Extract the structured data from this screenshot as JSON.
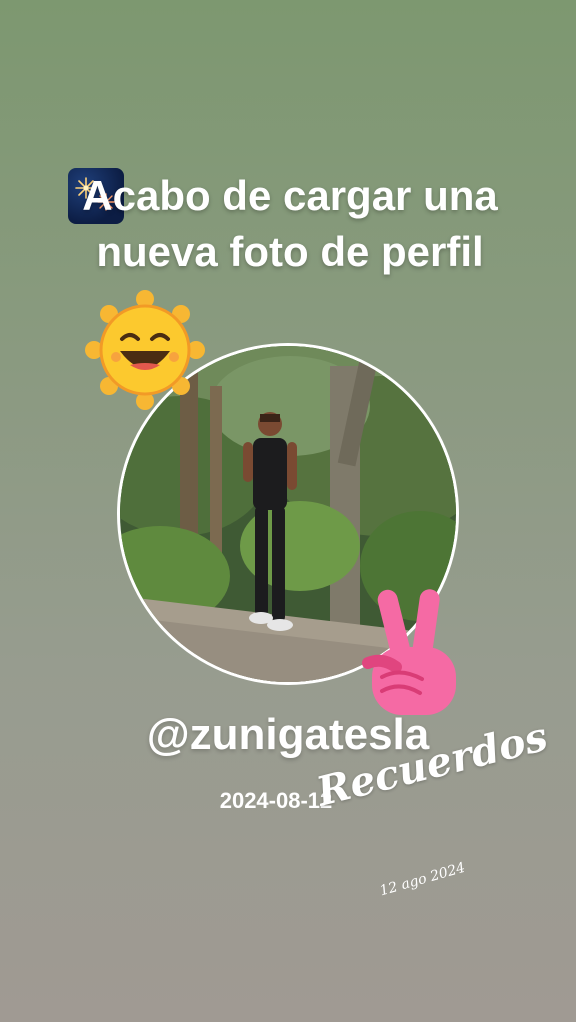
{
  "post": {
    "headline": "Acabo de cargar una nueva foto de perfil",
    "username": "@zunigatesla",
    "date": "2024-08-12"
  },
  "overlay": {
    "title": "Recuerdos",
    "stamp": "12 ago 2024"
  },
  "icons": {
    "fireworks": "fireworks-emoji",
    "sun": "grinning-sun-emoji",
    "peace": "peace-hand-emoji"
  },
  "colors": {
    "text": "#ffffff",
    "bg_top": "#7d9870",
    "bg_bottom": "#a09a93"
  }
}
